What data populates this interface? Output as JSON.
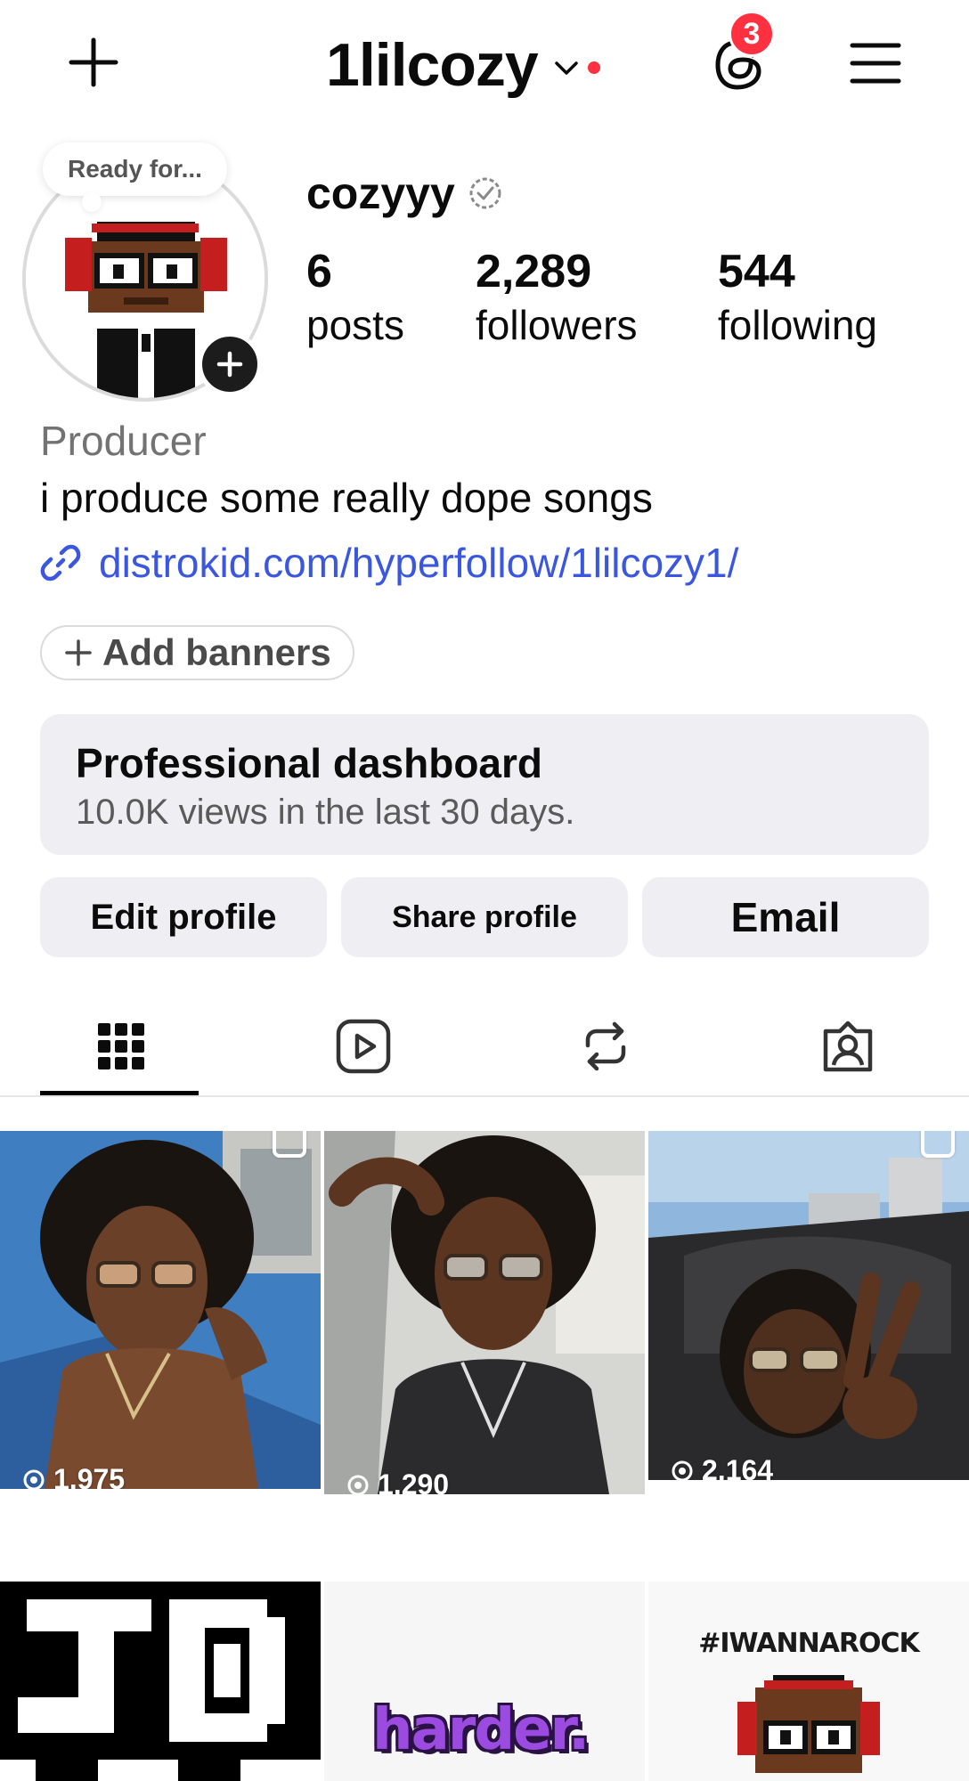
{
  "header": {
    "username": "1lilcozy",
    "threads_badge": "3"
  },
  "profile": {
    "note": "Ready for...",
    "display_name": "cozyyy",
    "stats": [
      {
        "value": "6",
        "label": "posts"
      },
      {
        "value": "2,289",
        "label": "followers"
      },
      {
        "value": "544",
        "label": "following"
      }
    ],
    "category": "Producer",
    "bio": "i produce some really dope songs",
    "link": "distrokid.com/hyperfollow/1lilcozy1/"
  },
  "add_banners": "Add banners",
  "dashboard": {
    "title": "Professional dashboard",
    "subtitle": "10.0K views in the last 30 days."
  },
  "actions": {
    "edit": "Edit profile",
    "share": "Share profile",
    "email": "Email"
  },
  "tabs": [
    "grid-icon",
    "reels-icon",
    "reposts-icon",
    "tagged-icon"
  ],
  "posts": [
    {
      "views": "1,975"
    },
    {
      "views": "1,290"
    },
    {
      "views": "2,164"
    },
    {
      "label": ""
    },
    {
      "label": "harder."
    },
    {
      "label": "#IWANNAROCK"
    }
  ],
  "colors": {
    "accent_red": "#ff3040",
    "link_blue": "#3b57e0",
    "chip_bg": "#efeff3"
  }
}
